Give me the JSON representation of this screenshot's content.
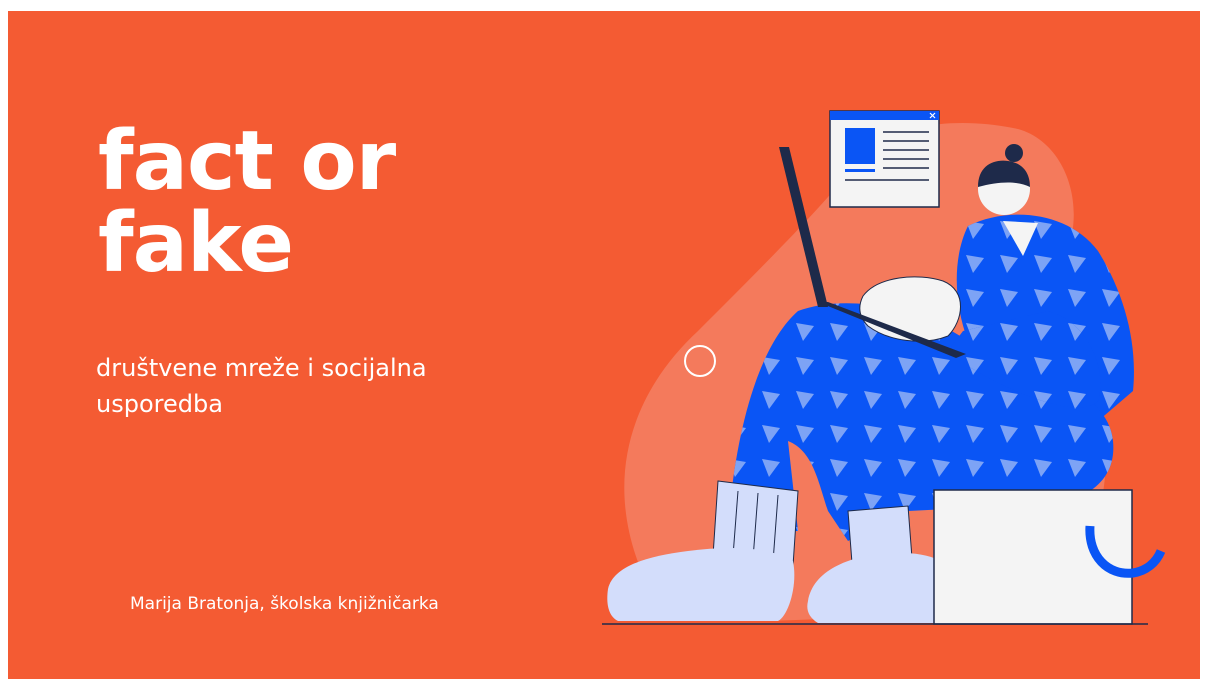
{
  "slide": {
    "title_line1": "fact or",
    "title_line2": "fake",
    "subtitle": "društvene mreže i socijalna usporedba",
    "author": "Marija Bratonja, školska knjižničarka"
  },
  "colors": {
    "background": "#F45B33",
    "text": "#FFFFFF",
    "blob": "#F47A5C",
    "pajamas": "#0A55F5",
    "triangles": "#7DA3F5",
    "socks": "#D3DDFB",
    "laptop": "#1E2A4A",
    "box": "#F4F4F4"
  },
  "illustration": {
    "subject": "person-with-laptop-illustration",
    "icons": [
      "browser-window-icon",
      "ring-icon",
      "arc-icon"
    ]
  }
}
